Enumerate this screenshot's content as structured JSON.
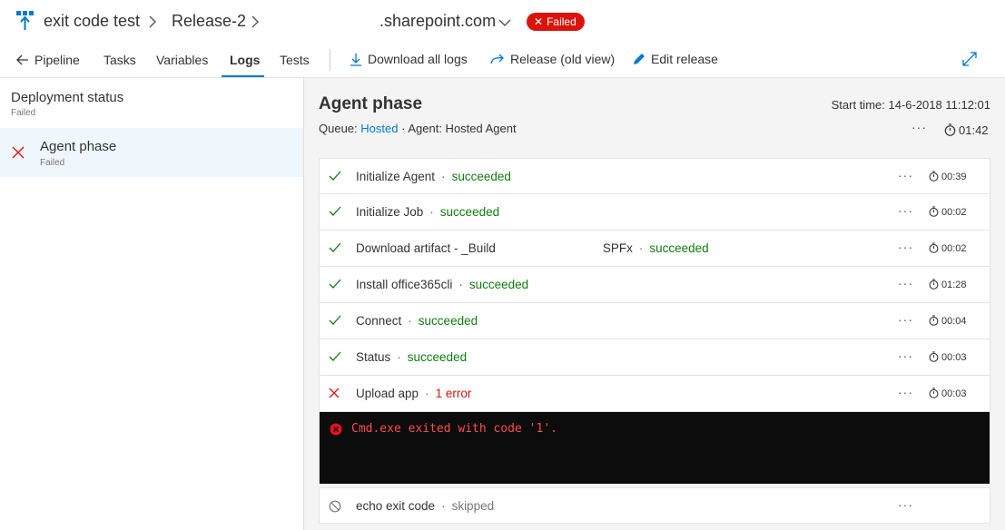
{
  "header": {
    "project": "exit code test",
    "release": "Release-2",
    "site": ".sharepoint.com",
    "status": "Failed"
  },
  "tabs": {
    "pipeline": "Pipeline",
    "tasks": "Tasks",
    "variables": "Variables",
    "logs": "Logs",
    "tests": "Tests"
  },
  "toolbar": {
    "download_all": "Download all logs",
    "release_old": "Release (old view)",
    "edit_release": "Edit release"
  },
  "left": {
    "deployment_title": "Deployment status",
    "deployment_status": "Failed",
    "agent_title": "Agent phase",
    "agent_status": "Failed"
  },
  "phase": {
    "title": "Agent phase",
    "queue_label": "Queue:",
    "queue_value": "Hosted",
    "agent": "Agent: Hosted Agent",
    "start_time": "Start time: 14-6-2018 11:12:01",
    "more": "···",
    "duration": "01:42"
  },
  "steps": [
    {
      "name": "Initialize Agent",
      "status": "succeeded",
      "duration": "00:39"
    },
    {
      "name": "Initialize Job",
      "status": "succeeded",
      "duration": "00:02"
    },
    {
      "name": "Download artifact - _Build",
      "suffix": "SPFx",
      "status": "succeeded",
      "duration": "00:02"
    },
    {
      "name": "Install office365cli",
      "status": "succeeded",
      "duration": "01:28"
    },
    {
      "name": "Connect",
      "status": "succeeded",
      "duration": "00:04"
    },
    {
      "name": "Status",
      "status": "succeeded",
      "duration": "00:03"
    },
    {
      "name": "Upload app",
      "status": "1 error",
      "duration": "00:03"
    },
    {
      "name": "echo exit code",
      "status": "skipped"
    }
  ],
  "console": {
    "message": "Cmd.exe exited with code '1'."
  },
  "common": {
    "dot": "·",
    "more": "···"
  },
  "colors": {
    "accent": "#0078d4",
    "failed": "#d9140d",
    "success": "#107c10"
  }
}
